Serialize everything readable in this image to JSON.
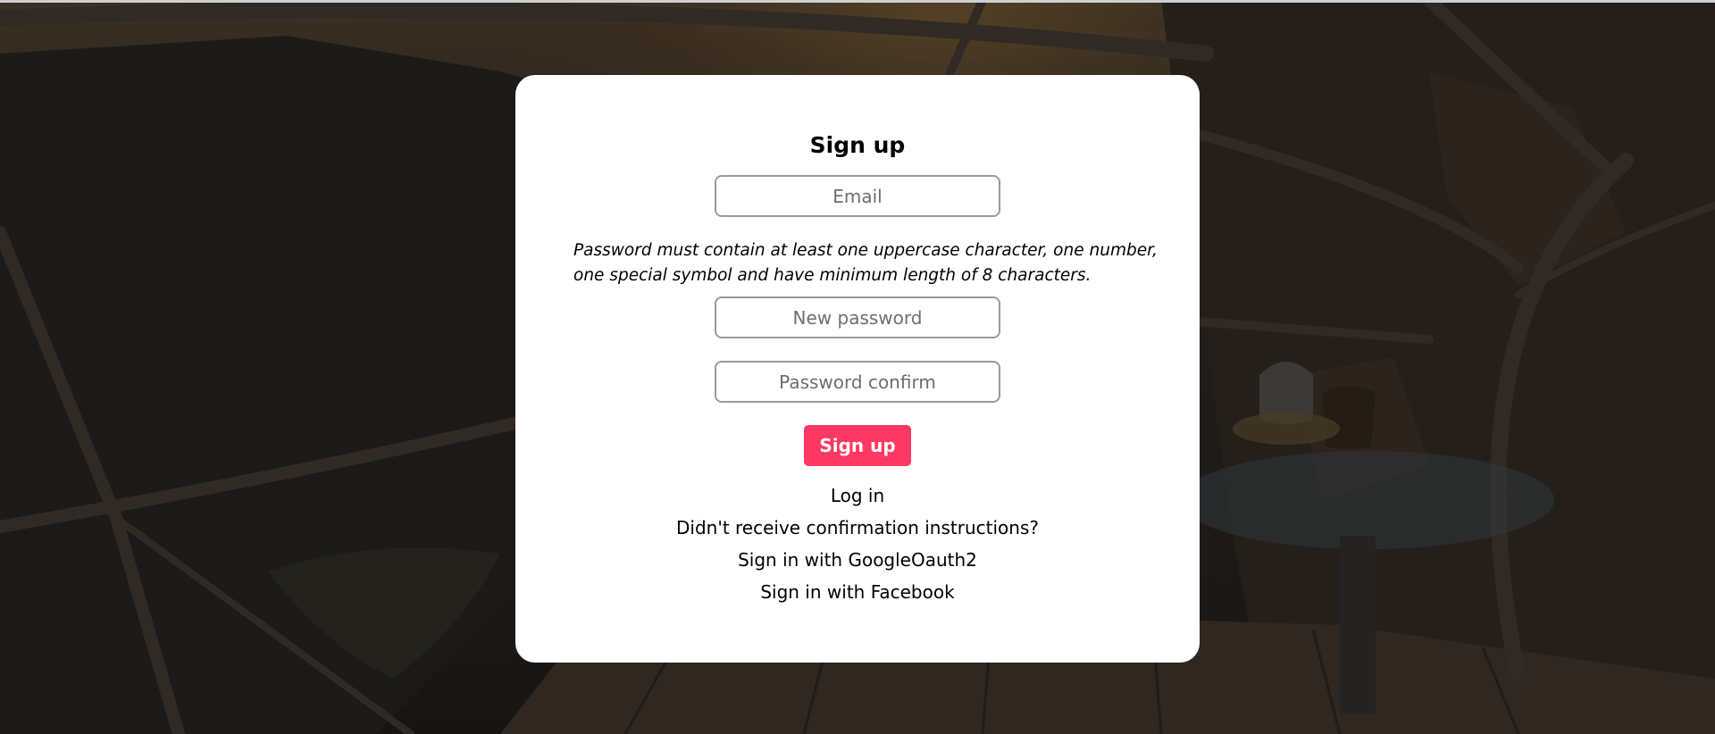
{
  "form": {
    "title": "Sign up",
    "email_placeholder": "Email",
    "password_hint": "Password must contain at least one uppercase character, one number, one special symbol and have minimum length of 8 characters.",
    "new_password_placeholder": "New password",
    "password_confirm_placeholder": "Password confirm",
    "submit_label": "Sign up"
  },
  "links": {
    "login": "Log in",
    "confirmation": "Didn't receive confirmation instructions?",
    "google": "Sign in with GoogleOauth2",
    "facebook": "Sign in with Facebook"
  },
  "colors": {
    "accent": "#fd3862",
    "card_background": "#ffffff",
    "input_border": "#9a9a9a"
  }
}
